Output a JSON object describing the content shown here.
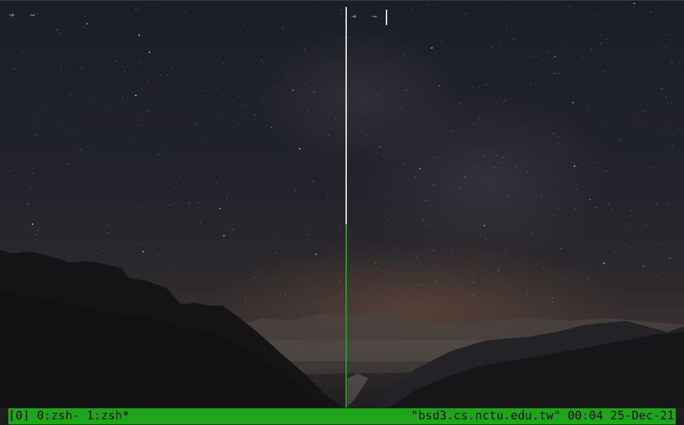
{
  "panes": [
    {
      "prompt_symbol": "➜",
      "cwd": "~",
      "active": false
    },
    {
      "prompt_symbol": "➜",
      "cwd": "~",
      "active": true
    }
  ],
  "status_bar": {
    "session": "[0]",
    "windows": "0:zsh- 1:zsh*",
    "host": "\"bsd3.cs.nctu.edu.tw\"",
    "time": "00:04",
    "date": "25-Dec-21"
  },
  "colors": {
    "prompt_arrow": "#2fbf2f",
    "cwd": "#3a9fdb",
    "status_bar_bg": "#1fa51a",
    "active_pane_border": "#21a31c",
    "inactive_pane_border": "#e6e6e6"
  }
}
